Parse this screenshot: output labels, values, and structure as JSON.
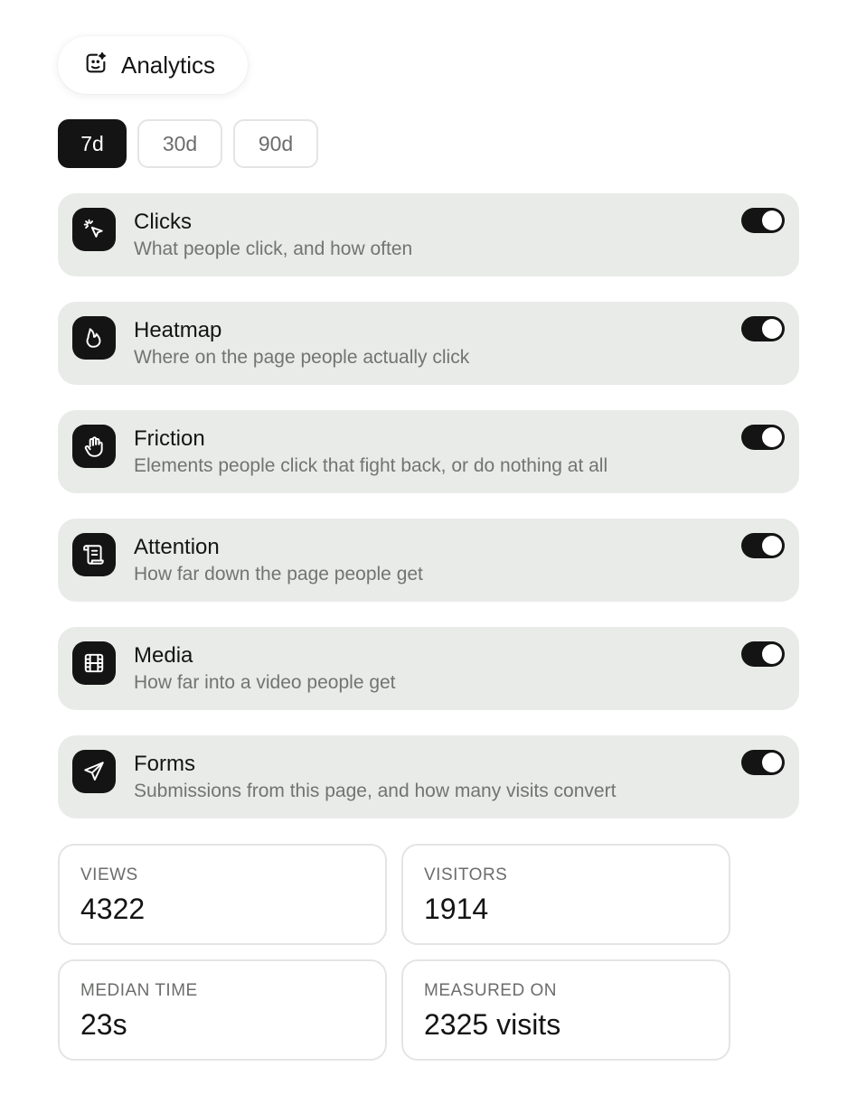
{
  "header": {
    "title": "Analytics",
    "icon": "analytics-sparkle-icon"
  },
  "ranges": [
    {
      "label": "7d",
      "active": true
    },
    {
      "label": "30d",
      "active": false
    },
    {
      "label": "90d",
      "active": false
    }
  ],
  "features": [
    {
      "title": "Clicks",
      "description": "What people click, and how often",
      "icon": "cursor-click-icon",
      "enabled": true
    },
    {
      "title": "Heatmap",
      "description": "Where on the page people actually click",
      "icon": "flame-icon",
      "enabled": true
    },
    {
      "title": "Friction",
      "description": "Elements people click that fight back, or do nothing at all",
      "icon": "hand-icon",
      "enabled": true
    },
    {
      "title": "Attention",
      "description": "How far down the page people get",
      "icon": "scroll-icon",
      "enabled": true
    },
    {
      "title": "Media",
      "description": "How far into a video people get",
      "icon": "film-icon",
      "enabled": true
    },
    {
      "title": "Forms",
      "description": "Submissions from this page, and how many visits convert",
      "icon": "send-icon",
      "enabled": true
    }
  ],
  "stats": [
    {
      "label": "VIEWS",
      "value": "4322"
    },
    {
      "label": "VISITORS",
      "value": "1914"
    },
    {
      "label": "MEDIAN TIME",
      "value": "23s"
    },
    {
      "label": "MEASURED ON",
      "value": "2325 visits"
    }
  ],
  "colors": {
    "accent": "#141414",
    "card_bg": "#e8ebe8",
    "muted_text": "#727472",
    "border": "#e3e5e3"
  }
}
